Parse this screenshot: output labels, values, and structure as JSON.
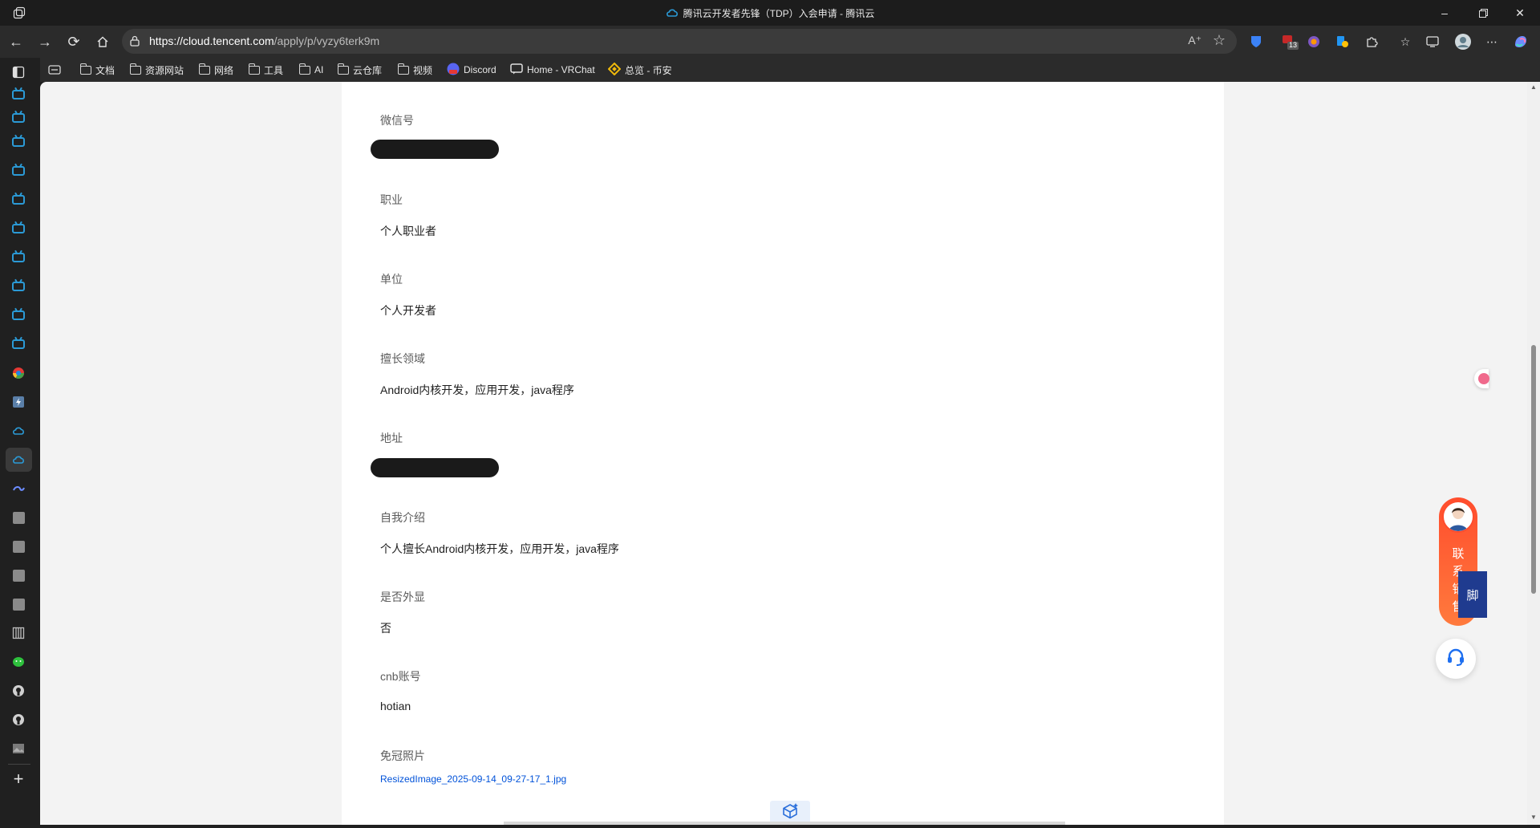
{
  "window": {
    "title": "腾讯云开发者先锋（TDP）入会申请 - 腾讯云",
    "controls": [
      "minimize-icon",
      "restore-icon",
      "close-icon"
    ]
  },
  "address_bar": {
    "url_host": "https://cloud.tencent.com",
    "url_path": "/apply/p/vyzy6terk9m"
  },
  "bookmarks": [
    {
      "label": "文档",
      "icon": "folder-icon"
    },
    {
      "label": "资源网站",
      "icon": "folder-icon"
    },
    {
      "label": "网络",
      "icon": "folder-icon"
    },
    {
      "label": "工具",
      "icon": "folder-icon"
    },
    {
      "label": "AI",
      "icon": "folder-icon"
    },
    {
      "label": "云仓库",
      "icon": "folder-icon"
    },
    {
      "label": "视频",
      "icon": "folder-icon"
    },
    {
      "label": "Discord",
      "icon": "discord-icon"
    },
    {
      "label": "Home - VRChat",
      "icon": "vrchat-icon"
    },
    {
      "label": "总览 - 币安",
      "icon": "binance-icon"
    }
  ],
  "extensions": {
    "badge_count": "13"
  },
  "form": {
    "wechat": {
      "label": "微信号",
      "value_redacted": true
    },
    "occupation": {
      "label": "职业",
      "value": "个人职业者"
    },
    "company": {
      "label": "单位",
      "value": "个人开发者"
    },
    "expertise": {
      "label": "擅长领域",
      "value": "Android内核开发，应用开发，java程序"
    },
    "address": {
      "label": "地址",
      "value_redacted": true
    },
    "intro": {
      "label": "自我介绍",
      "value": "个人擅长Android内核开发，应用开发，java程序"
    },
    "public": {
      "label": "是否外显",
      "value": "否"
    },
    "cnb": {
      "label": "cnb账号",
      "value": "hotian"
    },
    "photo": {
      "label": "免冠照片",
      "file": "ResizedImage_2025-09-14_09-27-17_1.jpg"
    }
  },
  "widgets": {
    "contact_text": "联系销售",
    "footer_button": "脚"
  },
  "colors": {
    "link": "#0052d9",
    "contact_gradient_start": "#ff4d2d",
    "sidebar_accent": "#2b9ad6"
  }
}
